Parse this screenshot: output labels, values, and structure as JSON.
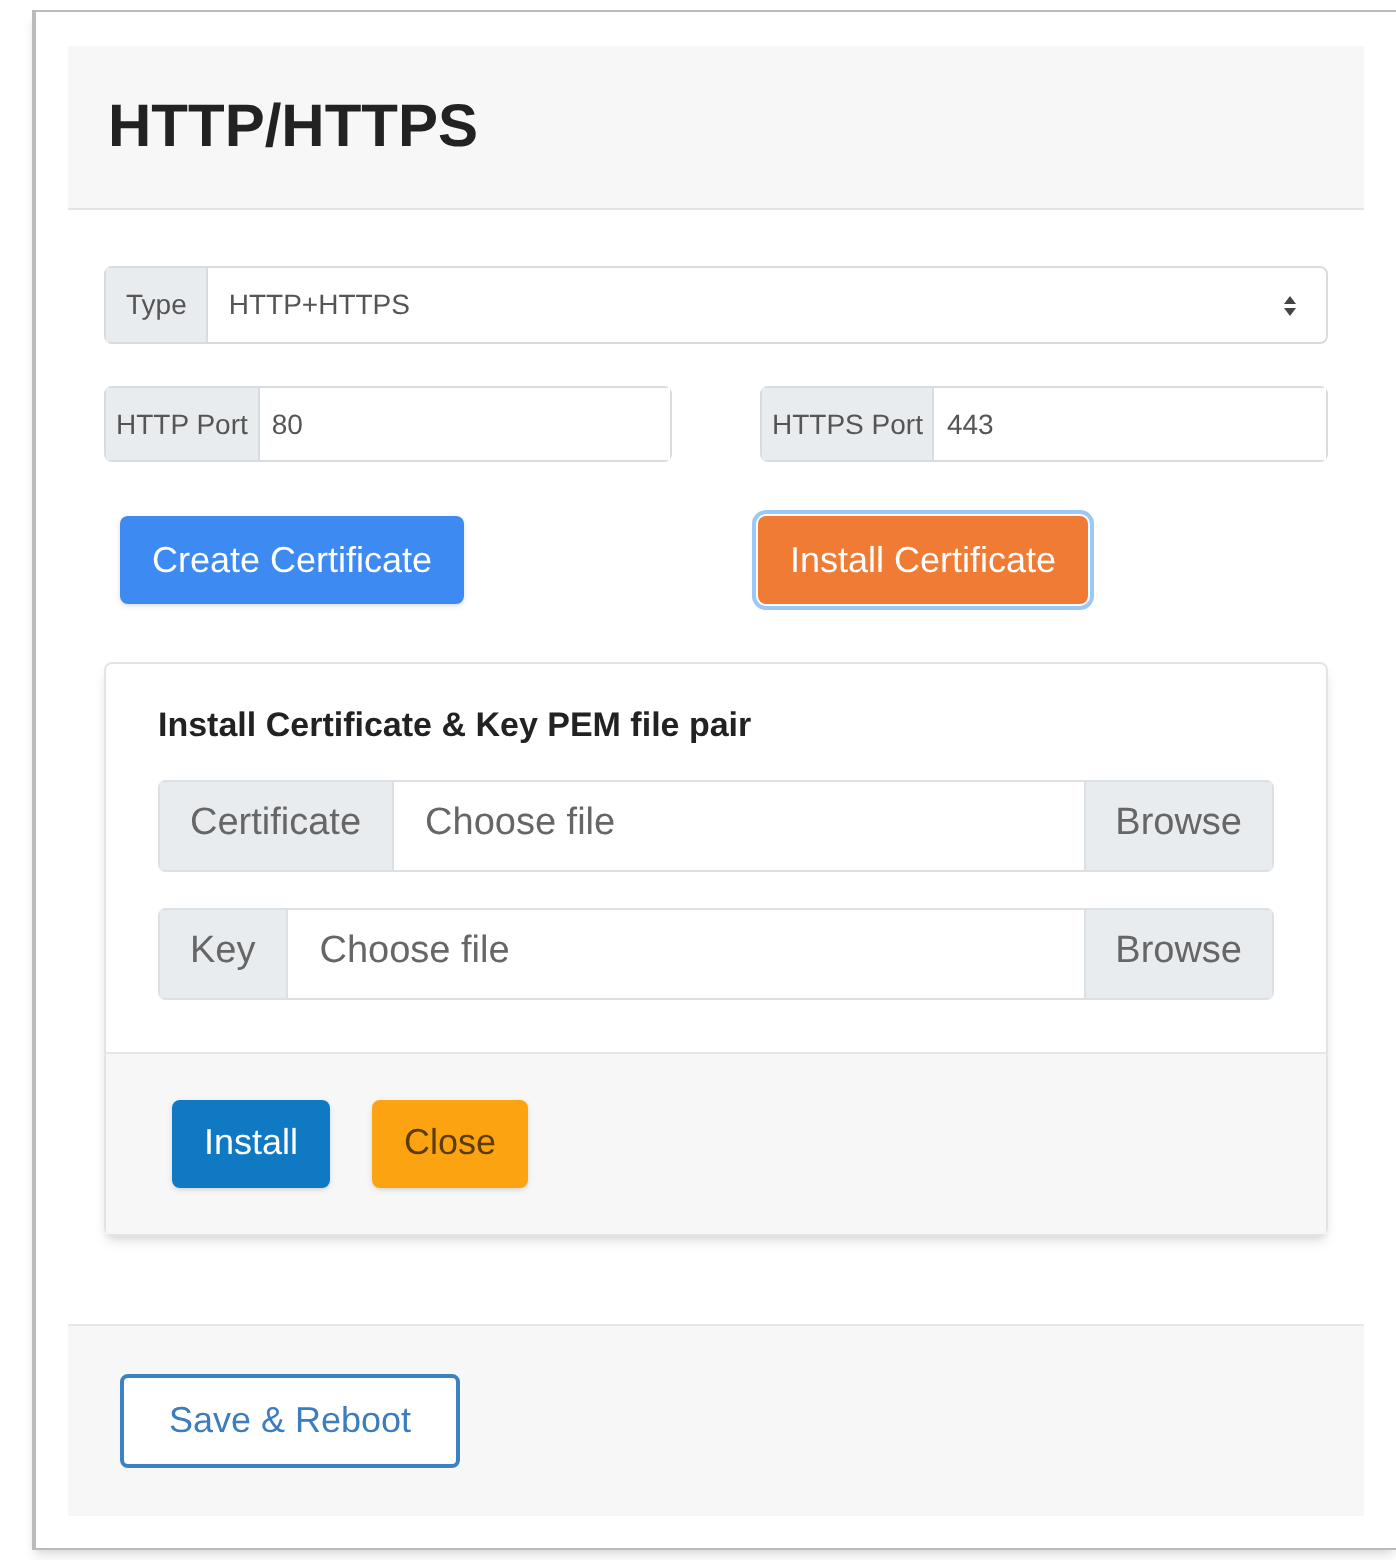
{
  "title": "HTTP/HTTPS",
  "type_field": {
    "label": "Type",
    "value": "HTTP+HTTPS"
  },
  "ports": [
    {
      "label": "HTTP Port",
      "value": "80"
    },
    {
      "label": "HTTPS Port",
      "value": "443"
    }
  ],
  "actions": [
    {
      "label": "Create Certificate",
      "kind": "primary",
      "focused": false
    },
    {
      "label": "Install Certificate",
      "kind": "orange",
      "focused": true
    }
  ],
  "install_panel": {
    "title": "Install Certificate & Key PEM file pair",
    "files": [
      {
        "label": "Certificate",
        "placeholder": "Choose file",
        "button": "Browse"
      },
      {
        "label": "Key",
        "placeholder": "Choose file",
        "button": "Browse"
      }
    ],
    "buttons": [
      {
        "label": "Install",
        "kind": "blue"
      },
      {
        "label": "Close",
        "kind": "amber"
      }
    ]
  },
  "footer_button": "Save & Reboot"
}
